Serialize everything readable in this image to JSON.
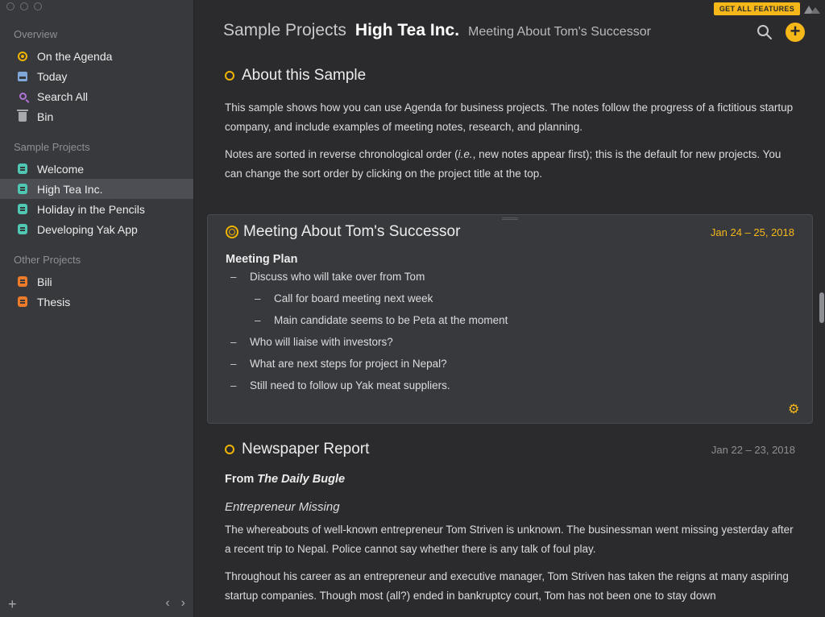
{
  "sidebar": {
    "overview_title": "Overview",
    "overview_items": [
      {
        "label": "On the Agenda",
        "icon": "agenda-icon"
      },
      {
        "label": "Today",
        "icon": "calendar-icon"
      },
      {
        "label": "Search All",
        "icon": "search-icon"
      },
      {
        "label": "Bin",
        "icon": "trash-icon"
      }
    ],
    "sample_title": "Sample Projects",
    "sample_items": [
      {
        "label": "Welcome",
        "icon": "project-icon"
      },
      {
        "label": "High Tea Inc.",
        "icon": "project-icon",
        "selected": true
      },
      {
        "label": "Holiday in the Pencils",
        "icon": "project-icon"
      },
      {
        "label": "Developing Yak App",
        "icon": "project-icon"
      }
    ],
    "other_title": "Other Projects",
    "other_items": [
      {
        "label": "Bili",
        "icon": "project-icon"
      },
      {
        "label": "Thesis",
        "icon": "project-icon"
      }
    ],
    "add_symbol": "+",
    "back_symbol": "‹",
    "forward_symbol": "›"
  },
  "header": {
    "group": "Sample Projects",
    "project": "High Tea Inc.",
    "note": "Meeting About Tom's Successor",
    "get_all_features": "GET ALL FEATURES",
    "plus_symbol": "+"
  },
  "notes": {
    "about": {
      "title": "About this Sample",
      "p1": "This sample shows how you can use Agenda for business projects. The notes follow the progress of a fictitious startup company, and include examples of meeting notes, research, and planning.",
      "p2_a": "Notes are sorted in reverse chronological order (",
      "p2_em": "i.e.",
      "p2_b": ", new notes appear first); this is the default for new projects. You can change the sort order by clicking on the project title at the top."
    },
    "meeting": {
      "title": "Meeting About Tom's Successor",
      "date": "Jan 24 – 25, 2018",
      "plan_heading": "Meeting Plan",
      "bullets": [
        "Discuss who will take over from Tom",
        "Call for board meeting next week",
        "Main candidate seems to be Peta at the moment",
        "Who will liaise with investors?",
        "What are next steps for project in Nepal?",
        "Still need to follow up Yak meat suppliers."
      ]
    },
    "newspaper": {
      "title": "Newspaper Report",
      "date": "Jan 22 – 23, 2018",
      "from_prefix": "From ",
      "from_source": "The Daily Bugle",
      "headline": "Entrepreneur Missing",
      "p1": "The whereabouts of well-known entrepreneur Tom Striven is unknown. The businessman went missing yesterday after a recent trip to Nepal. Police cannot say whether there is any talk of foul play.",
      "p2": "Throughout his career as an entrepreneur and executive manager, Tom Striven has taken the reigns at many aspiring startup companies. Though most (all?) ended in bankruptcy court, Tom has not been one to stay down"
    }
  },
  "colors": {
    "accent": "#f6b819",
    "sidebar_bg": "#38393d",
    "main_bg": "#2b2b2d",
    "project_teal": "#4fc7b3",
    "project_orange": "#ee7b2a"
  }
}
